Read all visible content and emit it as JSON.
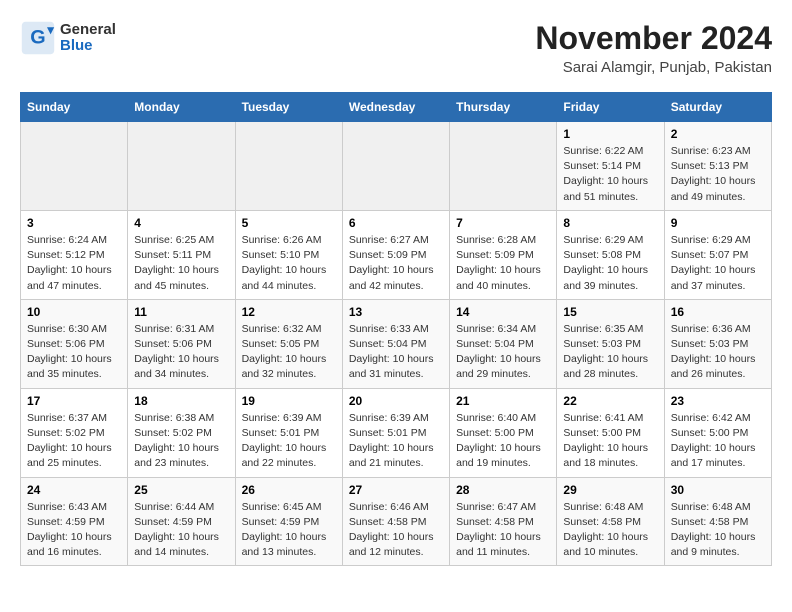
{
  "logo": {
    "general": "General",
    "blue": "Blue"
  },
  "title": "November 2024",
  "location": "Sarai Alamgir, Punjab, Pakistan",
  "headers": [
    "Sunday",
    "Monday",
    "Tuesday",
    "Wednesday",
    "Thursday",
    "Friday",
    "Saturday"
  ],
  "weeks": [
    [
      {
        "day": "",
        "info": ""
      },
      {
        "day": "",
        "info": ""
      },
      {
        "day": "",
        "info": ""
      },
      {
        "day": "",
        "info": ""
      },
      {
        "day": "",
        "info": ""
      },
      {
        "day": "1",
        "info": "Sunrise: 6:22 AM\nSunset: 5:14 PM\nDaylight: 10 hours\nand 51 minutes."
      },
      {
        "day": "2",
        "info": "Sunrise: 6:23 AM\nSunset: 5:13 PM\nDaylight: 10 hours\nand 49 minutes."
      }
    ],
    [
      {
        "day": "3",
        "info": "Sunrise: 6:24 AM\nSunset: 5:12 PM\nDaylight: 10 hours\nand 47 minutes."
      },
      {
        "day": "4",
        "info": "Sunrise: 6:25 AM\nSunset: 5:11 PM\nDaylight: 10 hours\nand 45 minutes."
      },
      {
        "day": "5",
        "info": "Sunrise: 6:26 AM\nSunset: 5:10 PM\nDaylight: 10 hours\nand 44 minutes."
      },
      {
        "day": "6",
        "info": "Sunrise: 6:27 AM\nSunset: 5:09 PM\nDaylight: 10 hours\nand 42 minutes."
      },
      {
        "day": "7",
        "info": "Sunrise: 6:28 AM\nSunset: 5:09 PM\nDaylight: 10 hours\nand 40 minutes."
      },
      {
        "day": "8",
        "info": "Sunrise: 6:29 AM\nSunset: 5:08 PM\nDaylight: 10 hours\nand 39 minutes."
      },
      {
        "day": "9",
        "info": "Sunrise: 6:29 AM\nSunset: 5:07 PM\nDaylight: 10 hours\nand 37 minutes."
      }
    ],
    [
      {
        "day": "10",
        "info": "Sunrise: 6:30 AM\nSunset: 5:06 PM\nDaylight: 10 hours\nand 35 minutes."
      },
      {
        "day": "11",
        "info": "Sunrise: 6:31 AM\nSunset: 5:06 PM\nDaylight: 10 hours\nand 34 minutes."
      },
      {
        "day": "12",
        "info": "Sunrise: 6:32 AM\nSunset: 5:05 PM\nDaylight: 10 hours\nand 32 minutes."
      },
      {
        "day": "13",
        "info": "Sunrise: 6:33 AM\nSunset: 5:04 PM\nDaylight: 10 hours\nand 31 minutes."
      },
      {
        "day": "14",
        "info": "Sunrise: 6:34 AM\nSunset: 5:04 PM\nDaylight: 10 hours\nand 29 minutes."
      },
      {
        "day": "15",
        "info": "Sunrise: 6:35 AM\nSunset: 5:03 PM\nDaylight: 10 hours\nand 28 minutes."
      },
      {
        "day": "16",
        "info": "Sunrise: 6:36 AM\nSunset: 5:03 PM\nDaylight: 10 hours\nand 26 minutes."
      }
    ],
    [
      {
        "day": "17",
        "info": "Sunrise: 6:37 AM\nSunset: 5:02 PM\nDaylight: 10 hours\nand 25 minutes."
      },
      {
        "day": "18",
        "info": "Sunrise: 6:38 AM\nSunset: 5:02 PM\nDaylight: 10 hours\nand 23 minutes."
      },
      {
        "day": "19",
        "info": "Sunrise: 6:39 AM\nSunset: 5:01 PM\nDaylight: 10 hours\nand 22 minutes."
      },
      {
        "day": "20",
        "info": "Sunrise: 6:39 AM\nSunset: 5:01 PM\nDaylight: 10 hours\nand 21 minutes."
      },
      {
        "day": "21",
        "info": "Sunrise: 6:40 AM\nSunset: 5:00 PM\nDaylight: 10 hours\nand 19 minutes."
      },
      {
        "day": "22",
        "info": "Sunrise: 6:41 AM\nSunset: 5:00 PM\nDaylight: 10 hours\nand 18 minutes."
      },
      {
        "day": "23",
        "info": "Sunrise: 6:42 AM\nSunset: 5:00 PM\nDaylight: 10 hours\nand 17 minutes."
      }
    ],
    [
      {
        "day": "24",
        "info": "Sunrise: 6:43 AM\nSunset: 4:59 PM\nDaylight: 10 hours\nand 16 minutes."
      },
      {
        "day": "25",
        "info": "Sunrise: 6:44 AM\nSunset: 4:59 PM\nDaylight: 10 hours\nand 14 minutes."
      },
      {
        "day": "26",
        "info": "Sunrise: 6:45 AM\nSunset: 4:59 PM\nDaylight: 10 hours\nand 13 minutes."
      },
      {
        "day": "27",
        "info": "Sunrise: 6:46 AM\nSunset: 4:58 PM\nDaylight: 10 hours\nand 12 minutes."
      },
      {
        "day": "28",
        "info": "Sunrise: 6:47 AM\nSunset: 4:58 PM\nDaylight: 10 hours\nand 11 minutes."
      },
      {
        "day": "29",
        "info": "Sunrise: 6:48 AM\nSunset: 4:58 PM\nDaylight: 10 hours\nand 10 minutes."
      },
      {
        "day": "30",
        "info": "Sunrise: 6:48 AM\nSunset: 4:58 PM\nDaylight: 10 hours\nand 9 minutes."
      }
    ]
  ]
}
